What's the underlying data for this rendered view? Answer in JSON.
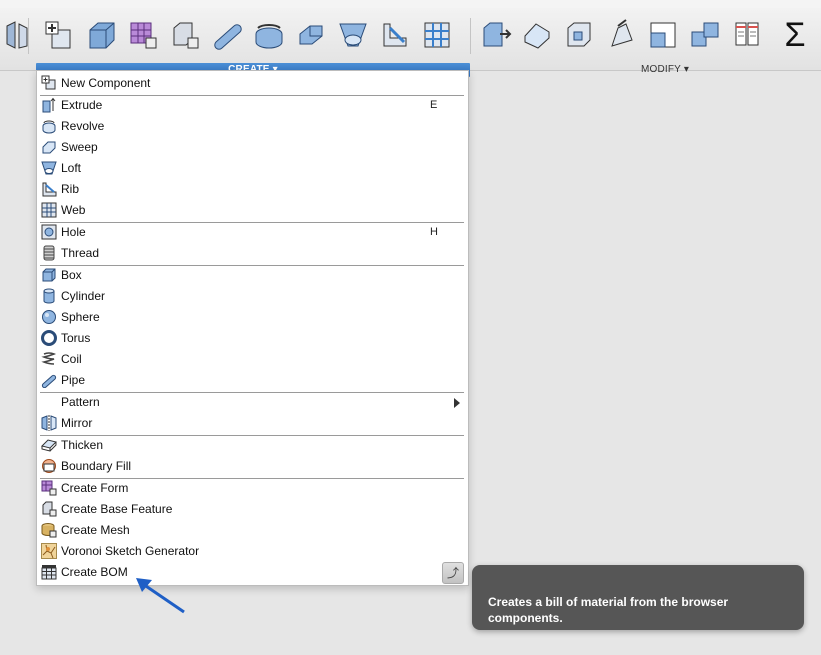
{
  "toolbar": {
    "sections": {
      "create_label": "CREATE ▾",
      "modify_label": "MODIFY ▾",
      "sum_symbol": "Σ"
    },
    "create_icons": [
      "new-component-icon",
      "box-icon",
      "create-form-icon",
      "create-base-feature-icon",
      "pipe-icon",
      "revolve-icon",
      "sweep-icon",
      "loft-icon",
      "rib-icon",
      "web-icon"
    ],
    "modify_icons": [
      "press-pull-icon",
      "fillet-icon",
      "shell-icon",
      "draft-icon",
      "scale-icon",
      "combine-icon",
      "change-parameters-icon"
    ]
  },
  "menu": {
    "items": [
      {
        "label": "New Component",
        "shortcut": "",
        "icon": "new-component-icon"
      },
      {
        "label": "Extrude",
        "shortcut": "E",
        "icon": "extrude-icon"
      },
      {
        "label": "Revolve",
        "shortcut": "",
        "icon": "revolve-icon"
      },
      {
        "label": "Sweep",
        "shortcut": "",
        "icon": "sweep-icon"
      },
      {
        "label": "Loft",
        "shortcut": "",
        "icon": "loft-icon"
      },
      {
        "label": "Rib",
        "shortcut": "",
        "icon": "rib-icon"
      },
      {
        "label": "Web",
        "shortcut": "",
        "icon": "web-icon"
      },
      {
        "label": "Hole",
        "shortcut": "H",
        "icon": "hole-icon"
      },
      {
        "label": "Thread",
        "shortcut": "",
        "icon": "thread-icon"
      },
      {
        "label": "Box",
        "shortcut": "",
        "icon": "box-icon"
      },
      {
        "label": "Cylinder",
        "shortcut": "",
        "icon": "cylinder-icon"
      },
      {
        "label": "Sphere",
        "shortcut": "",
        "icon": "sphere-icon"
      },
      {
        "label": "Torus",
        "shortcut": "",
        "icon": "torus-icon"
      },
      {
        "label": "Coil",
        "shortcut": "",
        "icon": "coil-icon"
      },
      {
        "label": "Pipe",
        "shortcut": "",
        "icon": "pipe-icon"
      },
      {
        "label": "Pattern",
        "shortcut": "",
        "icon": "submenu-arrow-icon"
      },
      {
        "label": "Mirror",
        "shortcut": "",
        "icon": "mirror-icon"
      },
      {
        "label": "Thicken",
        "shortcut": "",
        "icon": "thicken-icon"
      },
      {
        "label": "Boundary Fill",
        "shortcut": "",
        "icon": "boundary-fill-icon"
      },
      {
        "label": "Create Form",
        "shortcut": "",
        "icon": "create-form-icon"
      },
      {
        "label": "Create Base Feature",
        "shortcut": "",
        "icon": "create-base-feature-icon"
      },
      {
        "label": "Create Mesh",
        "shortcut": "",
        "icon": "create-mesh-icon"
      },
      {
        "label": "Voronoi Sketch Generator",
        "shortcut": "",
        "icon": "voronoi-icon"
      },
      {
        "label": "Create BOM",
        "shortcut": "",
        "icon": "bom-icon"
      }
    ],
    "pin_icon": "pin-icon"
  },
  "tooltip": {
    "text": "Creates a bill of material from the browser components."
  },
  "colors": {
    "accent": "#3a7fcb",
    "tooltip_bg": "#565656",
    "annotation_arrow": "#1f5fc6"
  }
}
